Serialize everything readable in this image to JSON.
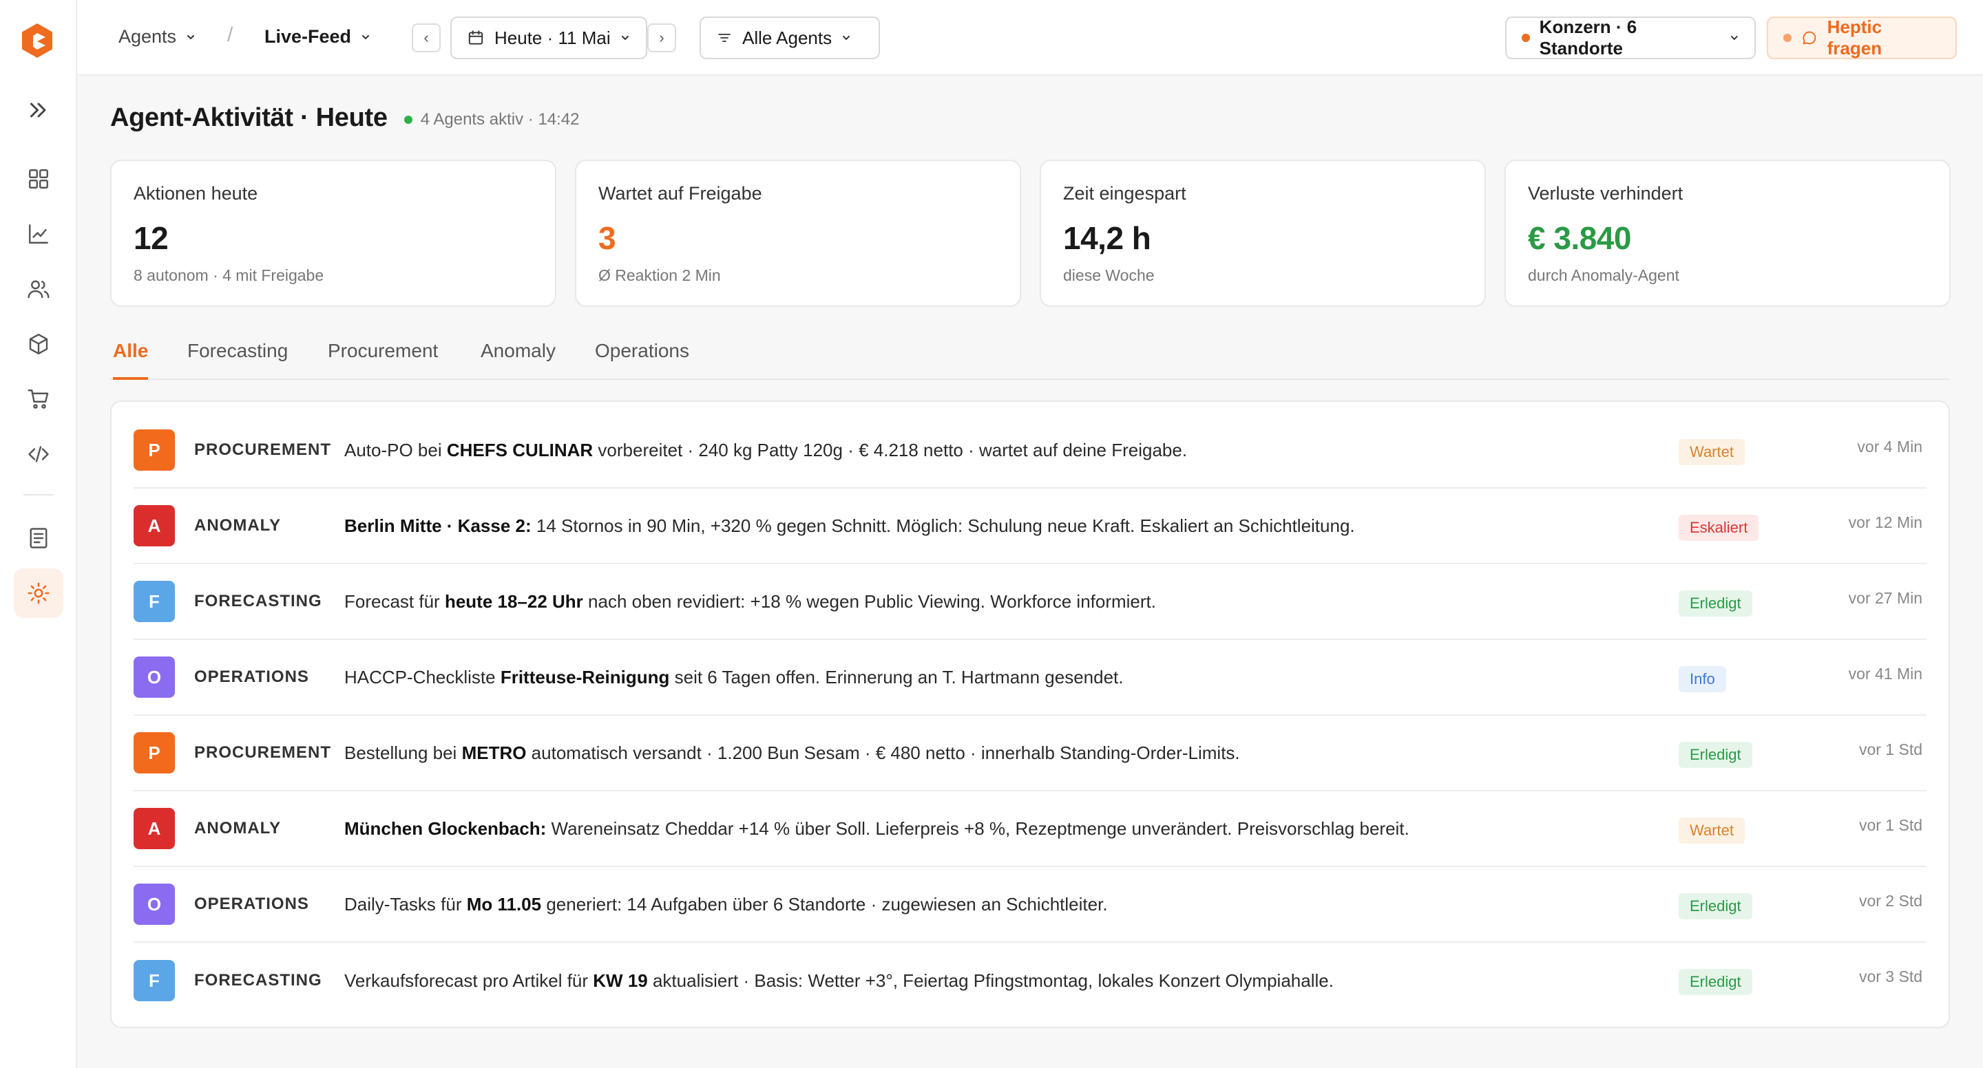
{
  "colors": {
    "accent": "#ee6b1f",
    "procurement": "#f26b1d",
    "anomaly": "#dc2d2d",
    "forecasting": "#5aa6e6",
    "operations": "#8a6cf0",
    "live": "#2bb34a",
    "success": "#2a9a44"
  },
  "sidebar": {
    "items": [
      {
        "icon": "expand-icon"
      },
      {
        "icon": "dashboard-icon"
      },
      {
        "icon": "chart-icon"
      },
      {
        "icon": "users-icon"
      },
      {
        "icon": "box-icon"
      },
      {
        "icon": "cart-icon"
      },
      {
        "icon": "code-icon"
      },
      {
        "icon": "document-icon"
      },
      {
        "icon": "agents-sun-icon",
        "active": true
      }
    ]
  },
  "topbar": {
    "breadcrumb_root": "Agents",
    "breadcrumb_current": "Live-Feed",
    "prev": "‹",
    "next": "›",
    "date": "Heute · 11 Mai",
    "filter": "Alle Agents",
    "scope": "Konzern · 6 Standorte",
    "ask": "Heptic fragen"
  },
  "heading": {
    "title": "Agent-Aktivität · Heute",
    "live_status": "4 Agents aktiv · 14:42"
  },
  "kpis": [
    {
      "label": "Aktionen heute",
      "value": "12",
      "sub": "8 autonom · 4 mit Freigabe",
      "color": "#1a1a1a"
    },
    {
      "label": "Wartet auf Freigabe",
      "value": "3",
      "sub": "Ø Reaktion 2 Min",
      "color": "#ee6b1f"
    },
    {
      "label": "Zeit eingespart",
      "value": "14,2 h",
      "sub": "diese Woche",
      "color": "#1a1a1a"
    },
    {
      "label": "Verluste verhindert",
      "value": "€ 3.840",
      "sub": "durch Anomaly-Agent",
      "color": "#2a9a44"
    }
  ],
  "tabs": [
    {
      "label": "Alle",
      "active": true
    },
    {
      "label": "Forecasting"
    },
    {
      "label": "Procurement"
    },
    {
      "label": "Anomaly"
    },
    {
      "label": "Operations"
    }
  ],
  "feed": [
    {
      "letter": "P",
      "agent": "PROCUREMENT",
      "color": "#f26b1d",
      "msg": [
        [
          "Auto-PO bei ",
          false
        ],
        [
          "CHEFS CULINAR",
          true
        ],
        [
          " vorbereitet · 240 kg Patty 120g · € 4.218 netto · wartet auf deine Freigabe.",
          false
        ]
      ],
      "status": "Wartet",
      "status_fg": "#d9822b",
      "status_bg": "#fdf1e3",
      "time": "vor 4 Min"
    },
    {
      "letter": "A",
      "agent": "ANOMALY",
      "color": "#dc2d2d",
      "msg": [
        [
          "Berlin Mitte · Kasse 2:",
          true
        ],
        [
          " 14 Stornos in 90 Min, +320 % gegen Schnitt. Möglich: Schulung neue Kraft. Eskaliert an Schichtleitung.",
          false
        ]
      ],
      "status": "Eskaliert",
      "status_fg": "#d93636",
      "status_bg": "#fde8e8",
      "time": "vor 12 Min"
    },
    {
      "letter": "F",
      "agent": "FORECASTING",
      "color": "#5aa6e6",
      "msg": [
        [
          "Forecast für ",
          false
        ],
        [
          "heute 18–22 Uhr",
          true
        ],
        [
          " nach oben revidiert: +18 % wegen Public Viewing. Workforce informiert.",
          false
        ]
      ],
      "status": "Erledigt",
      "status_fg": "#2a9a44",
      "status_bg": "#e6f5ea",
      "time": "vor 27 Min"
    },
    {
      "letter": "O",
      "agent": "OPERATIONS",
      "color": "#8a6cf0",
      "msg": [
        [
          "HACCP-Checkliste ",
          false
        ],
        [
          "Fritteuse-Reinigung",
          true
        ],
        [
          " seit 6 Tagen offen. Erinnerung an T. Hartmann gesendet.",
          false
        ]
      ],
      "status": "Info",
      "status_fg": "#3a78d6",
      "status_bg": "#e8f0fc",
      "time": "vor 41 Min"
    },
    {
      "letter": "P",
      "agent": "PROCUREMENT",
      "color": "#f26b1d",
      "msg": [
        [
          "Bestellung bei ",
          false
        ],
        [
          "METRO",
          true
        ],
        [
          " automatisch versandt · 1.200 Bun Sesam · € 480 netto · innerhalb Standing-Order-Limits.",
          false
        ]
      ],
      "status": "Erledigt",
      "status_fg": "#2a9a44",
      "status_bg": "#e6f5ea",
      "time": "vor 1 Std"
    },
    {
      "letter": "A",
      "agent": "ANOMALY",
      "color": "#dc2d2d",
      "msg": [
        [
          "München Glockenbach:",
          true
        ],
        [
          " Wareneinsatz Cheddar +14 % über Soll. Lieferpreis +8 %, Rezeptmenge unverändert. Preisvorschlag bereit.",
          false
        ]
      ],
      "status": "Wartet",
      "status_fg": "#d9822b",
      "status_bg": "#fdf1e3",
      "time": "vor 1 Std"
    },
    {
      "letter": "O",
      "agent": "OPERATIONS",
      "color": "#8a6cf0",
      "msg": [
        [
          "Daily-Tasks für ",
          false
        ],
        [
          "Mo 11.05",
          true
        ],
        [
          " generiert: 14 Aufgaben über 6 Standorte · zugewiesen an Schichtleiter.",
          false
        ]
      ],
      "status": "Erledigt",
      "status_fg": "#2a9a44",
      "status_bg": "#e6f5ea",
      "time": "vor 2 Std"
    },
    {
      "letter": "F",
      "agent": "FORECASTING",
      "color": "#5aa6e6",
      "msg": [
        [
          "Verkaufsforecast pro Artikel für ",
          false
        ],
        [
          "KW 19",
          true
        ],
        [
          " aktualisiert · Basis: Wetter +3°, Feiertag Pfingstmontag, lokales Konzert Olympiahalle.",
          false
        ]
      ],
      "status": "Erledigt",
      "status_fg": "#2a9a44",
      "status_bg": "#e6f5ea",
      "time": "vor 3 Std"
    }
  ]
}
